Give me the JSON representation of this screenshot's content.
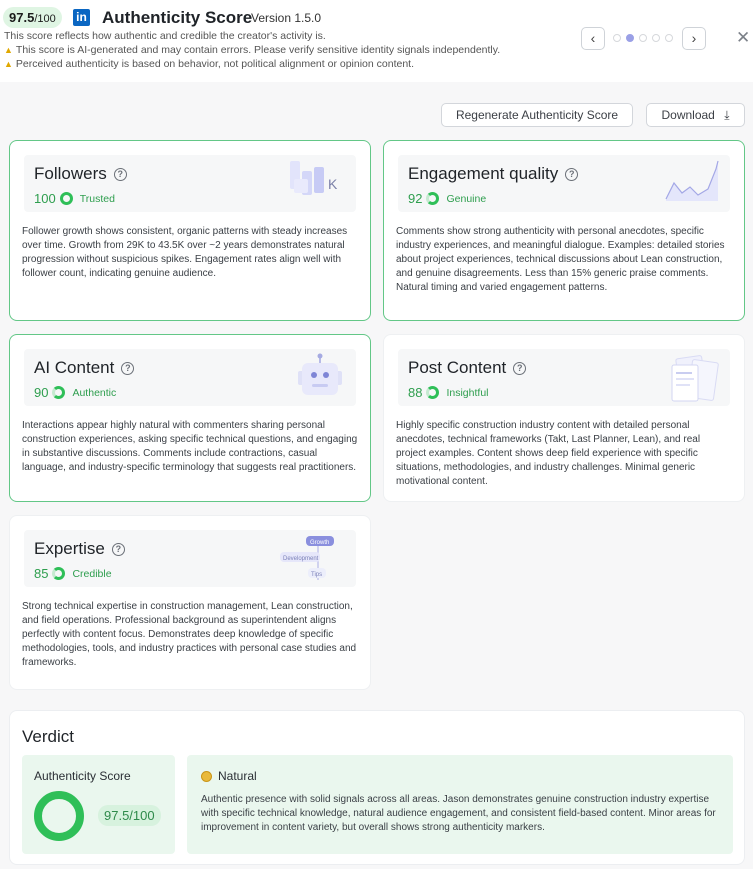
{
  "header": {
    "score": "97.5",
    "score_den": "/100",
    "linkedin_logo": "in",
    "title": "Authenticity Score",
    "version": "Version 1.5.0",
    "subtitle": "This score reflects how authentic and credible the creator's activity is.",
    "warning_1": "This score is AI-generated and may contain errors. Please verify sensitive identity signals independently.",
    "warning_2": "Perceived authenticity is based on behavior, not political alignment or opinion content.",
    "warning_icon": "warning-triangle-icon",
    "pager": {
      "total": 5,
      "active_index": 1
    }
  },
  "actions": {
    "regenerate_label": "Regenerate Authenticity Score",
    "download_label": "Download"
  },
  "cards": {
    "followers": {
      "title": "Followers",
      "score": "100",
      "label": "Trusted",
      "illus_text": "K",
      "body": "Follower growth shows consistent, organic patterns with steady increases over time. Growth from 29K to 43.5K over ~2 years demonstrates natural progression without suspicious spikes. Engagement rates align well with follower count, indicating genuine audience."
    },
    "engagement": {
      "title": "Engagement quality",
      "score": "92",
      "label": "Genuine",
      "body": "Comments show strong authenticity with personal anecdotes, specific industry experiences, and meaningful dialogue. Examples: detailed stories about project experiences, technical discussions about Lean construction, and genuine disagreements. Less than 15% generic praise comments. Natural timing and varied engagement patterns."
    },
    "ai_content": {
      "title": "AI Content",
      "score": "90",
      "label": "Authentic",
      "body": "Interactions appear highly natural with commenters sharing personal construction experiences, asking specific technical questions, and engaging in substantive discussions. Comments include contractions, casual language, and industry-specific terminology that suggests real practitioners."
    },
    "post_content": {
      "title": "Post Content",
      "score": "88",
      "label": "Insightful",
      "body": "Highly specific construction industry content with detailed personal anecdotes, technical frameworks (Takt, Last Planner, Lean), and real project examples. Content shows deep field experience with specific situations, methodologies, and industry challenges. Minimal generic motivational content."
    },
    "expertise": {
      "title": "Expertise",
      "score": "85",
      "label": "Credible",
      "illus_tags": [
        "Growth",
        "Development",
        "Tips"
      ],
      "body": "Strong technical expertise in construction management, Lean construction, and field operations. Professional background as superintendent aligns perfectly with content focus. Demonstrates deep knowledge of specific methodologies, tools, and industry practices with personal case studies and frameworks."
    }
  },
  "verdict": {
    "title": "Verdict",
    "score_label": "Authenticity Score",
    "score_value": "97.5/100",
    "tier": "Natural",
    "body": "Authentic presence with solid signals across all areas. Jason demonstrates genuine construction industry expertise with specific technical knowledge, natural audience engagement, and consistent field-based content. Minor areas for improvement in content variety, but overall shows strong authenticity markers."
  },
  "colors": {
    "accent_green": "#2fbf58",
    "card_border_green": "#63c787",
    "linkedin_blue": "#0a66c2",
    "pager_active": "#9aa0e6"
  }
}
